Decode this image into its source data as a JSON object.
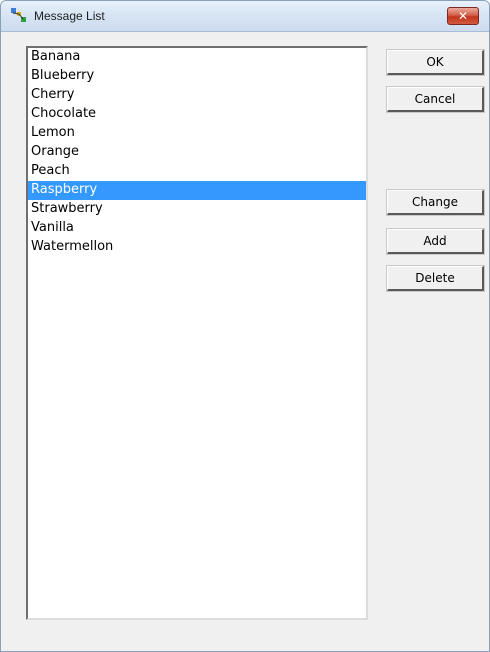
{
  "window": {
    "title": "Message List",
    "close_label": "✕"
  },
  "list": {
    "items": [
      "Banana",
      "Blueberry",
      "Cherry",
      "Chocolate",
      "Lemon",
      "Orange",
      "Peach",
      "Raspberry",
      "Strawberry",
      "Vanilla",
      "Watermellon"
    ],
    "selected": "Raspberry"
  },
  "buttons": {
    "ok": "OK",
    "cancel": "Cancel",
    "change": "Change",
    "add": "Add",
    "delete": "Delete"
  },
  "colors": {
    "selection": "#3399ff",
    "close_button": "#c1351c"
  }
}
